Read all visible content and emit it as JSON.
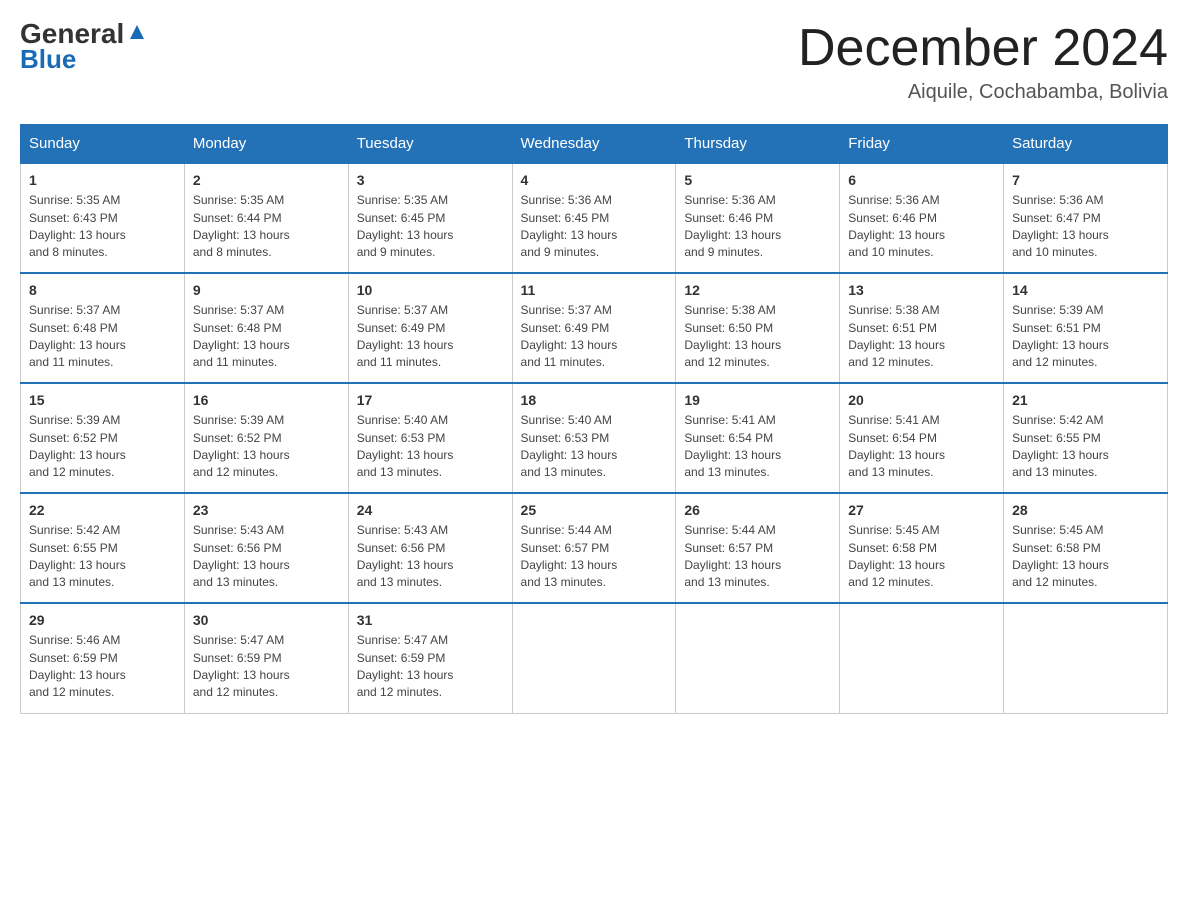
{
  "header": {
    "logo_general": "General",
    "logo_blue": "Blue",
    "month_title": "December 2024",
    "location": "Aiquile, Cochabamba, Bolivia"
  },
  "days_of_week": [
    "Sunday",
    "Monday",
    "Tuesday",
    "Wednesday",
    "Thursday",
    "Friday",
    "Saturday"
  ],
  "weeks": [
    [
      {
        "day": "1",
        "sunrise": "5:35 AM",
        "sunset": "6:43 PM",
        "daylight": "13 hours and 8 minutes."
      },
      {
        "day": "2",
        "sunrise": "5:35 AM",
        "sunset": "6:44 PM",
        "daylight": "13 hours and 8 minutes."
      },
      {
        "day": "3",
        "sunrise": "5:35 AM",
        "sunset": "6:45 PM",
        "daylight": "13 hours and 9 minutes."
      },
      {
        "day": "4",
        "sunrise": "5:36 AM",
        "sunset": "6:45 PM",
        "daylight": "13 hours and 9 minutes."
      },
      {
        "day": "5",
        "sunrise": "5:36 AM",
        "sunset": "6:46 PM",
        "daylight": "13 hours and 9 minutes."
      },
      {
        "day": "6",
        "sunrise": "5:36 AM",
        "sunset": "6:46 PM",
        "daylight": "13 hours and 10 minutes."
      },
      {
        "day": "7",
        "sunrise": "5:36 AM",
        "sunset": "6:47 PM",
        "daylight": "13 hours and 10 minutes."
      }
    ],
    [
      {
        "day": "8",
        "sunrise": "5:37 AM",
        "sunset": "6:48 PM",
        "daylight": "13 hours and 11 minutes."
      },
      {
        "day": "9",
        "sunrise": "5:37 AM",
        "sunset": "6:48 PM",
        "daylight": "13 hours and 11 minutes."
      },
      {
        "day": "10",
        "sunrise": "5:37 AM",
        "sunset": "6:49 PM",
        "daylight": "13 hours and 11 minutes."
      },
      {
        "day": "11",
        "sunrise": "5:37 AM",
        "sunset": "6:49 PM",
        "daylight": "13 hours and 11 minutes."
      },
      {
        "day": "12",
        "sunrise": "5:38 AM",
        "sunset": "6:50 PM",
        "daylight": "13 hours and 12 minutes."
      },
      {
        "day": "13",
        "sunrise": "5:38 AM",
        "sunset": "6:51 PM",
        "daylight": "13 hours and 12 minutes."
      },
      {
        "day": "14",
        "sunrise": "5:39 AM",
        "sunset": "6:51 PM",
        "daylight": "13 hours and 12 minutes."
      }
    ],
    [
      {
        "day": "15",
        "sunrise": "5:39 AM",
        "sunset": "6:52 PM",
        "daylight": "13 hours and 12 minutes."
      },
      {
        "day": "16",
        "sunrise": "5:39 AM",
        "sunset": "6:52 PM",
        "daylight": "13 hours and 12 minutes."
      },
      {
        "day": "17",
        "sunrise": "5:40 AM",
        "sunset": "6:53 PM",
        "daylight": "13 hours and 13 minutes."
      },
      {
        "day": "18",
        "sunrise": "5:40 AM",
        "sunset": "6:53 PM",
        "daylight": "13 hours and 13 minutes."
      },
      {
        "day": "19",
        "sunrise": "5:41 AM",
        "sunset": "6:54 PM",
        "daylight": "13 hours and 13 minutes."
      },
      {
        "day": "20",
        "sunrise": "5:41 AM",
        "sunset": "6:54 PM",
        "daylight": "13 hours and 13 minutes."
      },
      {
        "day": "21",
        "sunrise": "5:42 AM",
        "sunset": "6:55 PM",
        "daylight": "13 hours and 13 minutes."
      }
    ],
    [
      {
        "day": "22",
        "sunrise": "5:42 AM",
        "sunset": "6:55 PM",
        "daylight": "13 hours and 13 minutes."
      },
      {
        "day": "23",
        "sunrise": "5:43 AM",
        "sunset": "6:56 PM",
        "daylight": "13 hours and 13 minutes."
      },
      {
        "day": "24",
        "sunrise": "5:43 AM",
        "sunset": "6:56 PM",
        "daylight": "13 hours and 13 minutes."
      },
      {
        "day": "25",
        "sunrise": "5:44 AM",
        "sunset": "6:57 PM",
        "daylight": "13 hours and 13 minutes."
      },
      {
        "day": "26",
        "sunrise": "5:44 AM",
        "sunset": "6:57 PM",
        "daylight": "13 hours and 13 minutes."
      },
      {
        "day": "27",
        "sunrise": "5:45 AM",
        "sunset": "6:58 PM",
        "daylight": "13 hours and 12 minutes."
      },
      {
        "day": "28",
        "sunrise": "5:45 AM",
        "sunset": "6:58 PM",
        "daylight": "13 hours and 12 minutes."
      }
    ],
    [
      {
        "day": "29",
        "sunrise": "5:46 AM",
        "sunset": "6:59 PM",
        "daylight": "13 hours and 12 minutes."
      },
      {
        "day": "30",
        "sunrise": "5:47 AM",
        "sunset": "6:59 PM",
        "daylight": "13 hours and 12 minutes."
      },
      {
        "day": "31",
        "sunrise": "5:47 AM",
        "sunset": "6:59 PM",
        "daylight": "13 hours and 12 minutes."
      },
      null,
      null,
      null,
      null
    ]
  ]
}
